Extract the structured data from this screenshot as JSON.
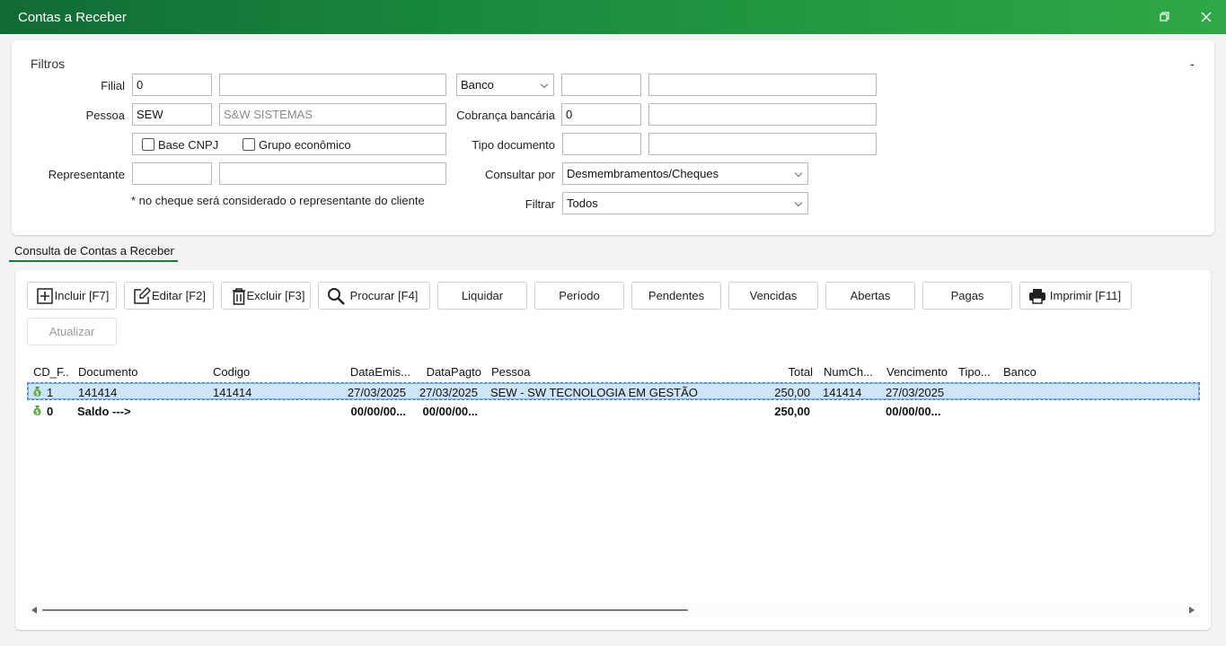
{
  "window": {
    "title": "Contas a Receber",
    "restore_icon": "restore-icon",
    "close_icon": "close-icon"
  },
  "filters": {
    "legend": "Filtros",
    "collapse": "-",
    "filial_label": "Filial",
    "filial_code": "0",
    "filial_name": "",
    "pessoa_label": "Pessoa",
    "pessoa_code": "SEW",
    "pessoa_name": "S&W SISTEMAS",
    "base_cnpj_label": "Base CNPJ",
    "grupo_label": "Grupo econômico",
    "representante_label": "Representante",
    "representante_code": "",
    "representante_name": "",
    "note": "* no cheque será considerado o representante do cliente",
    "banco_select": "Banco",
    "banco_code": "",
    "banco_name": "",
    "cobranca_label": "Cobrança bancária",
    "cobranca_value": "0",
    "cobranca_name": "",
    "tipo_doc_label": "Tipo documento",
    "tipo_doc_code": "",
    "tipo_doc_name": "",
    "consultar_label": "Consultar por",
    "consultar_value": "Desmembramentos/Cheques",
    "filtrar_label": "Filtrar",
    "filtrar_value": "Todos"
  },
  "section_tab": "Consulta de Contas a Receber",
  "toolbar": {
    "incluir": "Incluir [F7]",
    "editar": "Editar [F2]",
    "excluir": "Excluir [F3]",
    "procurar": "Procurar [F4]",
    "liquidar": "Liquidar",
    "periodo": "Período",
    "pendentes": "Pendentes",
    "vencidas": "Vencidas",
    "abertas": "Abertas",
    "pagas": "Pagas",
    "imprimir": "Imprimir [F11]",
    "atualizar": "Atualizar"
  },
  "grid": {
    "columns": [
      "CD_F...",
      "Documento",
      "Codigo",
      "DataEmis...",
      "DataPagto",
      "Pessoa",
      "Total",
      "NumCh...",
      "Vencimento",
      "Tipo...",
      "Banco"
    ],
    "rows": [
      {
        "cd": "1",
        "documento": "141414",
        "codigo": "141414",
        "emissao": "27/03/2025",
        "pagto": "27/03/2025",
        "pessoa": "SEW - SW TECNOLOGIA EM GESTÃO",
        "total": "250,00",
        "numch": "141414",
        "vencimento": "27/03/2025",
        "tipo": "",
        "banco": ""
      },
      {
        "cd": "0",
        "documento": "Saldo --->",
        "codigo": "",
        "emissao": "00/00/00...",
        "pagto": "00/00/00...",
        "pessoa": "",
        "total": "250,00",
        "numch": "",
        "vencimento": "00/00/00...",
        "tipo": "",
        "banco": ""
      }
    ]
  },
  "colors": {
    "title_bar_start": "#116b35",
    "title_bar_end": "#2fa845",
    "accent": "#1b7a3a",
    "selected_row": "#cde5f7"
  }
}
